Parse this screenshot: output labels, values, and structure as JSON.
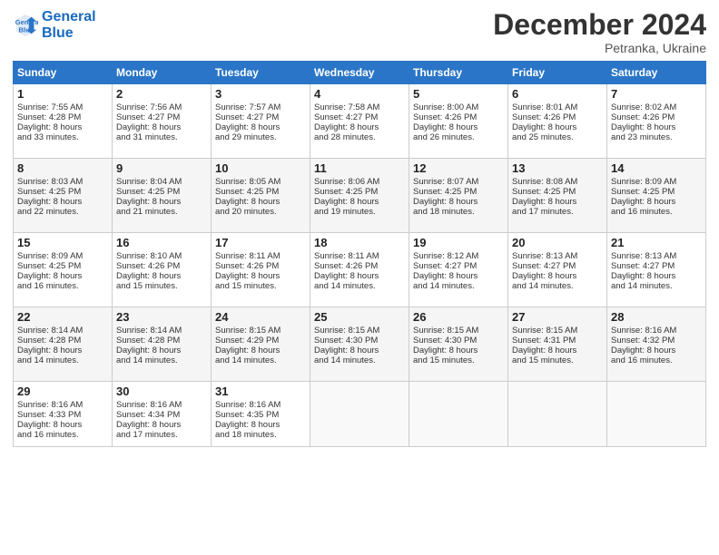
{
  "header": {
    "logo_line1": "General",
    "logo_line2": "Blue",
    "month": "December 2024",
    "location": "Petranka, Ukraine"
  },
  "weekdays": [
    "Sunday",
    "Monday",
    "Tuesday",
    "Wednesday",
    "Thursday",
    "Friday",
    "Saturday"
  ],
  "weeks": [
    [
      {
        "day": "1",
        "lines": [
          "Sunrise: 7:55 AM",
          "Sunset: 4:28 PM",
          "Daylight: 8 hours",
          "and 33 minutes."
        ]
      },
      {
        "day": "2",
        "lines": [
          "Sunrise: 7:56 AM",
          "Sunset: 4:27 PM",
          "Daylight: 8 hours",
          "and 31 minutes."
        ]
      },
      {
        "day": "3",
        "lines": [
          "Sunrise: 7:57 AM",
          "Sunset: 4:27 PM",
          "Daylight: 8 hours",
          "and 29 minutes."
        ]
      },
      {
        "day": "4",
        "lines": [
          "Sunrise: 7:58 AM",
          "Sunset: 4:27 PM",
          "Daylight: 8 hours",
          "and 28 minutes."
        ]
      },
      {
        "day": "5",
        "lines": [
          "Sunrise: 8:00 AM",
          "Sunset: 4:26 PM",
          "Daylight: 8 hours",
          "and 26 minutes."
        ]
      },
      {
        "day": "6",
        "lines": [
          "Sunrise: 8:01 AM",
          "Sunset: 4:26 PM",
          "Daylight: 8 hours",
          "and 25 minutes."
        ]
      },
      {
        "day": "7",
        "lines": [
          "Sunrise: 8:02 AM",
          "Sunset: 4:26 PM",
          "Daylight: 8 hours",
          "and 23 minutes."
        ]
      }
    ],
    [
      {
        "day": "8",
        "lines": [
          "Sunrise: 8:03 AM",
          "Sunset: 4:25 PM",
          "Daylight: 8 hours",
          "and 22 minutes."
        ]
      },
      {
        "day": "9",
        "lines": [
          "Sunrise: 8:04 AM",
          "Sunset: 4:25 PM",
          "Daylight: 8 hours",
          "and 21 minutes."
        ]
      },
      {
        "day": "10",
        "lines": [
          "Sunrise: 8:05 AM",
          "Sunset: 4:25 PM",
          "Daylight: 8 hours",
          "and 20 minutes."
        ]
      },
      {
        "day": "11",
        "lines": [
          "Sunrise: 8:06 AM",
          "Sunset: 4:25 PM",
          "Daylight: 8 hours",
          "and 19 minutes."
        ]
      },
      {
        "day": "12",
        "lines": [
          "Sunrise: 8:07 AM",
          "Sunset: 4:25 PM",
          "Daylight: 8 hours",
          "and 18 minutes."
        ]
      },
      {
        "day": "13",
        "lines": [
          "Sunrise: 8:08 AM",
          "Sunset: 4:25 PM",
          "Daylight: 8 hours",
          "and 17 minutes."
        ]
      },
      {
        "day": "14",
        "lines": [
          "Sunrise: 8:09 AM",
          "Sunset: 4:25 PM",
          "Daylight: 8 hours",
          "and 16 minutes."
        ]
      }
    ],
    [
      {
        "day": "15",
        "lines": [
          "Sunrise: 8:09 AM",
          "Sunset: 4:25 PM",
          "Daylight: 8 hours",
          "and 16 minutes."
        ]
      },
      {
        "day": "16",
        "lines": [
          "Sunrise: 8:10 AM",
          "Sunset: 4:26 PM",
          "Daylight: 8 hours",
          "and 15 minutes."
        ]
      },
      {
        "day": "17",
        "lines": [
          "Sunrise: 8:11 AM",
          "Sunset: 4:26 PM",
          "Daylight: 8 hours",
          "and 15 minutes."
        ]
      },
      {
        "day": "18",
        "lines": [
          "Sunrise: 8:11 AM",
          "Sunset: 4:26 PM",
          "Daylight: 8 hours",
          "and 14 minutes."
        ]
      },
      {
        "day": "19",
        "lines": [
          "Sunrise: 8:12 AM",
          "Sunset: 4:27 PM",
          "Daylight: 8 hours",
          "and 14 minutes."
        ]
      },
      {
        "day": "20",
        "lines": [
          "Sunrise: 8:13 AM",
          "Sunset: 4:27 PM",
          "Daylight: 8 hours",
          "and 14 minutes."
        ]
      },
      {
        "day": "21",
        "lines": [
          "Sunrise: 8:13 AM",
          "Sunset: 4:27 PM",
          "Daylight: 8 hours",
          "and 14 minutes."
        ]
      }
    ],
    [
      {
        "day": "22",
        "lines": [
          "Sunrise: 8:14 AM",
          "Sunset: 4:28 PM",
          "Daylight: 8 hours",
          "and 14 minutes."
        ]
      },
      {
        "day": "23",
        "lines": [
          "Sunrise: 8:14 AM",
          "Sunset: 4:28 PM",
          "Daylight: 8 hours",
          "and 14 minutes."
        ]
      },
      {
        "day": "24",
        "lines": [
          "Sunrise: 8:15 AM",
          "Sunset: 4:29 PM",
          "Daylight: 8 hours",
          "and 14 minutes."
        ]
      },
      {
        "day": "25",
        "lines": [
          "Sunrise: 8:15 AM",
          "Sunset: 4:30 PM",
          "Daylight: 8 hours",
          "and 14 minutes."
        ]
      },
      {
        "day": "26",
        "lines": [
          "Sunrise: 8:15 AM",
          "Sunset: 4:30 PM",
          "Daylight: 8 hours",
          "and 15 minutes."
        ]
      },
      {
        "day": "27",
        "lines": [
          "Sunrise: 8:15 AM",
          "Sunset: 4:31 PM",
          "Daylight: 8 hours",
          "and 15 minutes."
        ]
      },
      {
        "day": "28",
        "lines": [
          "Sunrise: 8:16 AM",
          "Sunset: 4:32 PM",
          "Daylight: 8 hours",
          "and 16 minutes."
        ]
      }
    ],
    [
      {
        "day": "29",
        "lines": [
          "Sunrise: 8:16 AM",
          "Sunset: 4:33 PM",
          "Daylight: 8 hours",
          "and 16 minutes."
        ]
      },
      {
        "day": "30",
        "lines": [
          "Sunrise: 8:16 AM",
          "Sunset: 4:34 PM",
          "Daylight: 8 hours",
          "and 17 minutes."
        ]
      },
      {
        "day": "31",
        "lines": [
          "Sunrise: 8:16 AM",
          "Sunset: 4:35 PM",
          "Daylight: 8 hours",
          "and 18 minutes."
        ]
      },
      null,
      null,
      null,
      null
    ]
  ]
}
